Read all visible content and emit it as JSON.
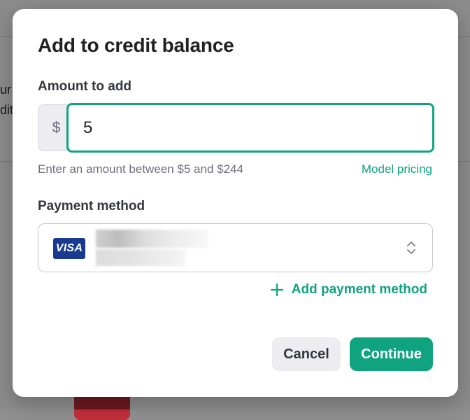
{
  "background": {
    "text_line_1": "ur",
    "text_line_2": "dit"
  },
  "modal": {
    "title": "Add to credit balance",
    "amount": {
      "label": "Amount to add",
      "currency_symbol": "$",
      "value": "5",
      "helper_text": "Enter an amount between $5 and $244",
      "pricing_link": "Model pricing"
    },
    "payment": {
      "label": "Payment method",
      "card_brand": "VISA",
      "card_brand_color": "#1a3a8f",
      "select_icon": "chevron-up-down-icon"
    },
    "add_payment": {
      "label": "Add payment method",
      "icon": "plus-icon"
    },
    "actions": {
      "cancel_label": "Cancel",
      "continue_label": "Continue"
    }
  },
  "colors": {
    "accent": "#10a37f",
    "cancel_bg": "#ececf1",
    "overlay": "rgba(0,0,0,0.45)"
  }
}
